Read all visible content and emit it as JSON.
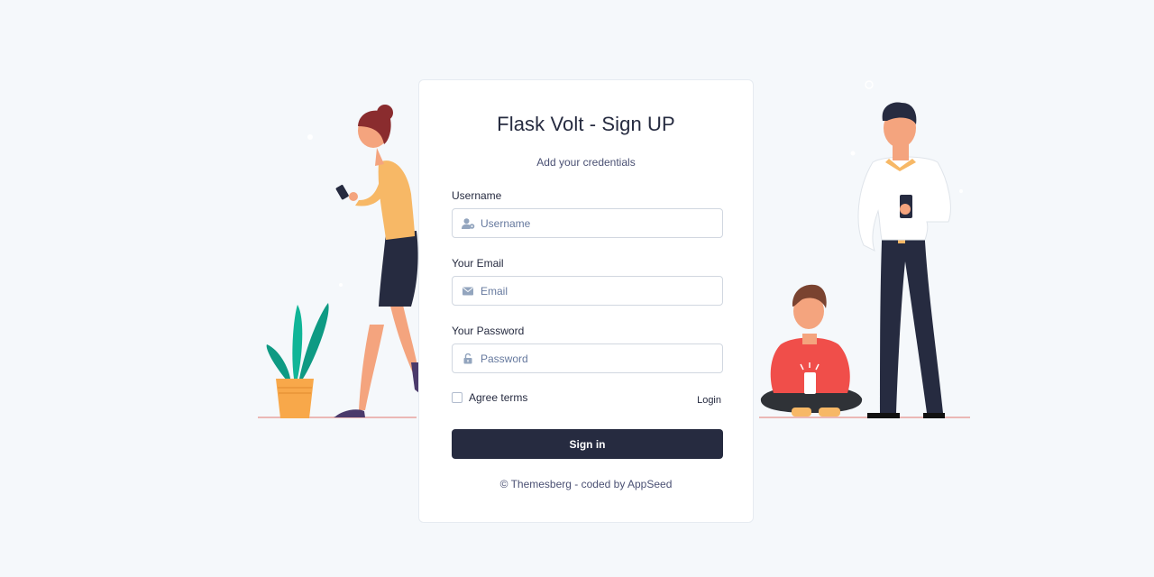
{
  "signup": {
    "title": "Flask Volt - Sign UP",
    "subtitle": "Add your credentials",
    "username": {
      "label": "Username",
      "placeholder": "Username",
      "icon": "user-icon"
    },
    "email": {
      "label": "Your Email",
      "placeholder": "Email",
      "icon": "envelope-icon"
    },
    "password": {
      "label": "Your Password",
      "placeholder": "Password",
      "icon": "unlock-icon"
    },
    "agree_label": "Agree terms",
    "login_label": "Login",
    "submit_label": "Sign in",
    "footer": {
      "copyright": "© Themesberg",
      "separator": "- coded by",
      "author": "AppSeed"
    }
  },
  "colors": {
    "background": "#f5f8fb",
    "primary": "#262b40",
    "text": "#4a5073",
    "icon": "#93a5be"
  }
}
